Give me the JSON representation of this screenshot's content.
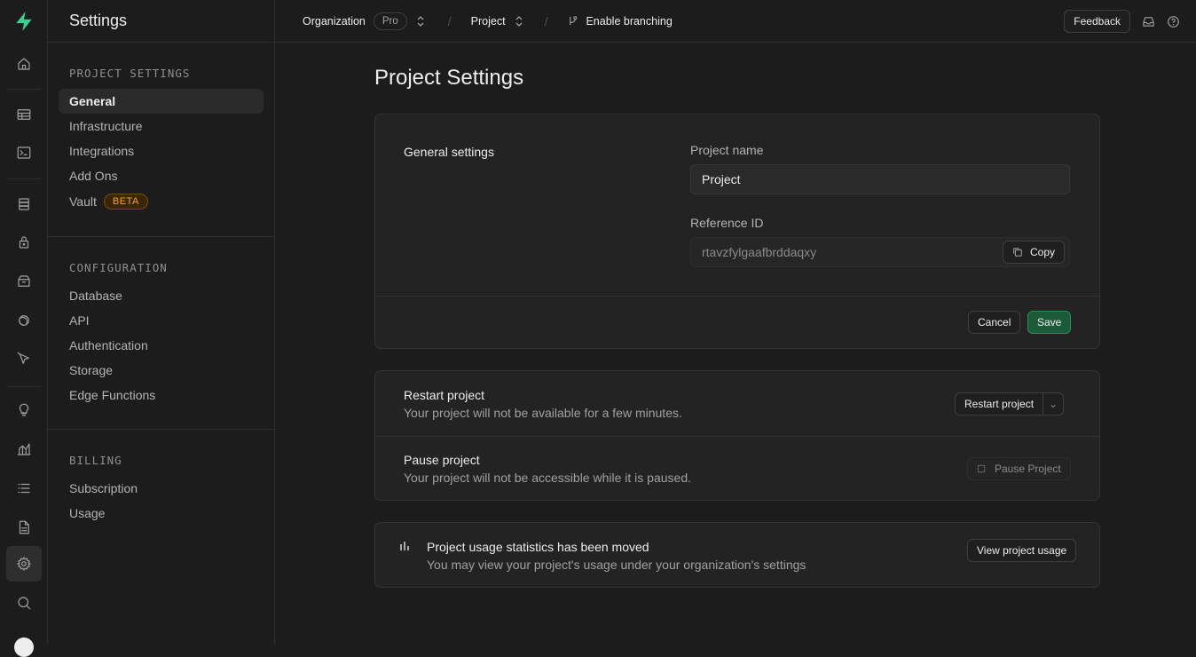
{
  "app": {
    "logo": "supabase-bolt-logo",
    "accent": "#3ecf8e"
  },
  "rail": {
    "icons": [
      "home-icon",
      "table-editor-icon",
      "sql-editor-icon",
      "database-icon",
      "auth-lock-icon",
      "storage-icon",
      "realtime-icon",
      "edge-functions-icon",
      "advisors-bulb-icon",
      "reports-icon",
      "logs-icon",
      "api-docs-icon",
      "settings-gear-icon",
      "search-icon"
    ]
  },
  "menu": {
    "title": "Settings",
    "sections": [
      {
        "heading": "PROJECT SETTINGS",
        "items": [
          "General",
          "Infrastructure",
          "Integrations",
          "Add Ons",
          "Vault"
        ]
      },
      {
        "heading": "CONFIGURATION",
        "items": [
          "Database",
          "API",
          "Authentication",
          "Storage",
          "Edge Functions"
        ]
      },
      {
        "heading": "BILLING",
        "items": [
          "Subscription",
          "Usage"
        ]
      }
    ],
    "active_item": "General",
    "vault_badge": "BETA"
  },
  "topbar": {
    "org_label": "Organization",
    "plan_pill": "Pro",
    "project_label": "Project",
    "branching_label": "Enable branching",
    "feedback_label": "Feedback"
  },
  "main": {
    "title": "Project Settings",
    "general": {
      "heading": "General settings",
      "name_label": "Project name",
      "name_value": "Project",
      "ref_label": "Reference ID",
      "ref_value": "rtavzfylgaafbrddaqxy",
      "copy_label": "Copy",
      "cancel_label": "Cancel",
      "save_label": "Save"
    },
    "restart": {
      "title": "Restart project",
      "desc": "Your project will not be available for a few minutes.",
      "button": "Restart project"
    },
    "pause": {
      "title": "Pause project",
      "desc": "Your project will not be accessible while it is paused.",
      "button": "Pause Project"
    },
    "usage": {
      "title": "Project usage statistics has been moved",
      "desc": "You may view your project's usage under your organization's settings",
      "button": "View project usage"
    }
  }
}
